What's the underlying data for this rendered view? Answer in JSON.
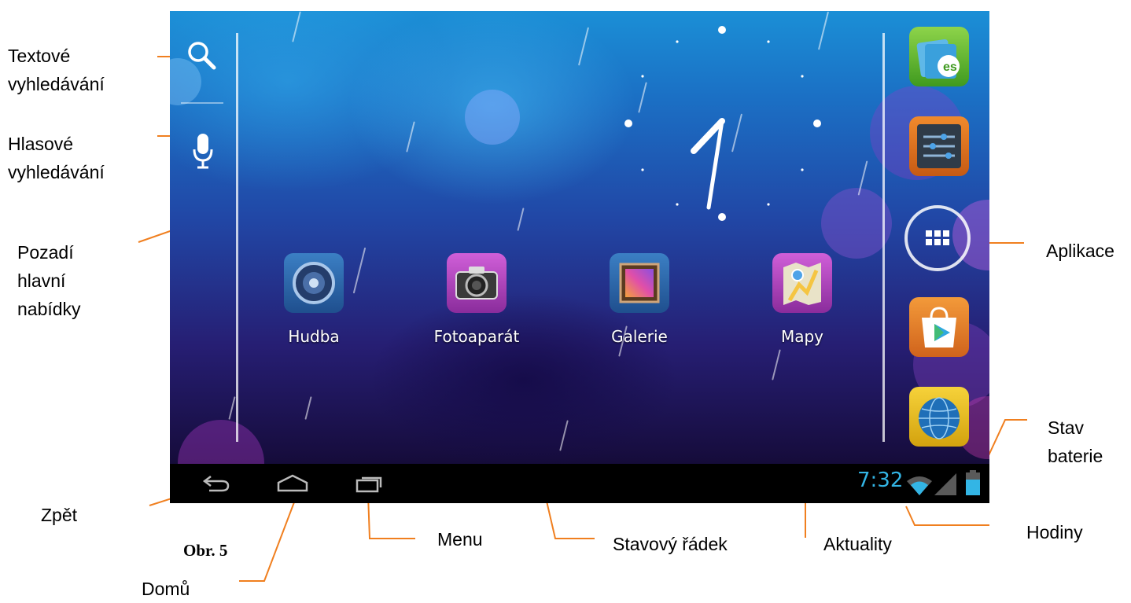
{
  "figure_label": "Obr. 5",
  "callouts": {
    "text_search": [
      "Textové",
      "vyhledávání"
    ],
    "voice_search": [
      "Hlasové",
      "vyhledávání"
    ],
    "wallpaper": [
      "Pozadí",
      "hlavní",
      "nabídky"
    ],
    "apps": "Aplikace",
    "battery": [
      "Stav",
      "baterie"
    ],
    "back": "Zpět",
    "home": "Domů",
    "menu": "Menu",
    "status_bar": "Stavový řádek",
    "notifications": "Aktuality",
    "clock": "Hodiny"
  },
  "home_apps": [
    {
      "label": "Hudba",
      "icon": "speaker-icon"
    },
    {
      "label": "Fotoaparát",
      "icon": "camera-icon"
    },
    {
      "label": "Galerie",
      "icon": "gallery-icon"
    },
    {
      "label": "Mapy",
      "icon": "maps-icon"
    }
  ],
  "dock": [
    "es-file-explorer-icon",
    "settings-icon",
    "all-apps-icon",
    "play-store-icon",
    "browser-globe-icon"
  ],
  "status_bar": {
    "time": "7:32",
    "icons": [
      "wifi-icon",
      "signal-icon",
      "battery-icon"
    ]
  },
  "colors": {
    "clock": "#33b5e5",
    "callout_line": "#f07f1f",
    "navbar": "#000000"
  }
}
